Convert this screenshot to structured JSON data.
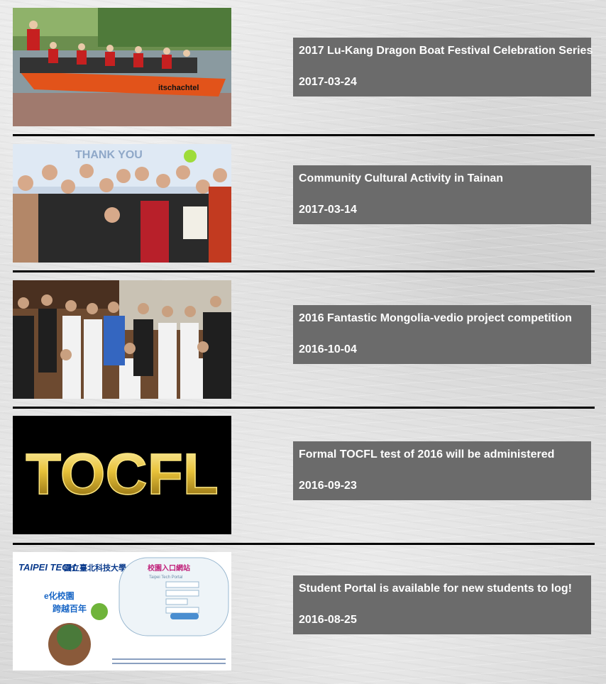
{
  "news": [
    {
      "title": "2017 Lu-Kang Dragon Boat Festival Celebration Series",
      "date": "2017-03-24",
      "image": "dragon-boat-photo",
      "boat_text": "itschachtel"
    },
    {
      "title": "Community Cultural Activity in Tainan",
      "date": "2017-03-14",
      "image": "cultural-group-photo",
      "banner_text": "THANK YOU"
    },
    {
      "title": "2016 Fantastic Mongolia-vedio project competition",
      "date": "2016-10-04",
      "image": "competition-group-photo"
    },
    {
      "title": "Formal TOCFL test of 2016 will be administered",
      "date": "2016-09-23",
      "image": "tocfl-logo",
      "logo_text": "TOCFL"
    },
    {
      "title": "Student Portal is available for new students to log!",
      "date": "2016-08-25",
      "image": "student-portal-screenshot",
      "portal": {
        "brand": "TAIPEI TECH",
        "school": "國立臺北科技大學",
        "slogan1": "e化校園",
        "slogan2": "跨越百年",
        "portal_title": "校園入口網站",
        "portal_subtitle": "Taipei Tech Portal"
      }
    }
  ],
  "colors": {
    "card_bg": "#6b6b6b",
    "card_text": "#ffffff",
    "separator": "#000000"
  }
}
